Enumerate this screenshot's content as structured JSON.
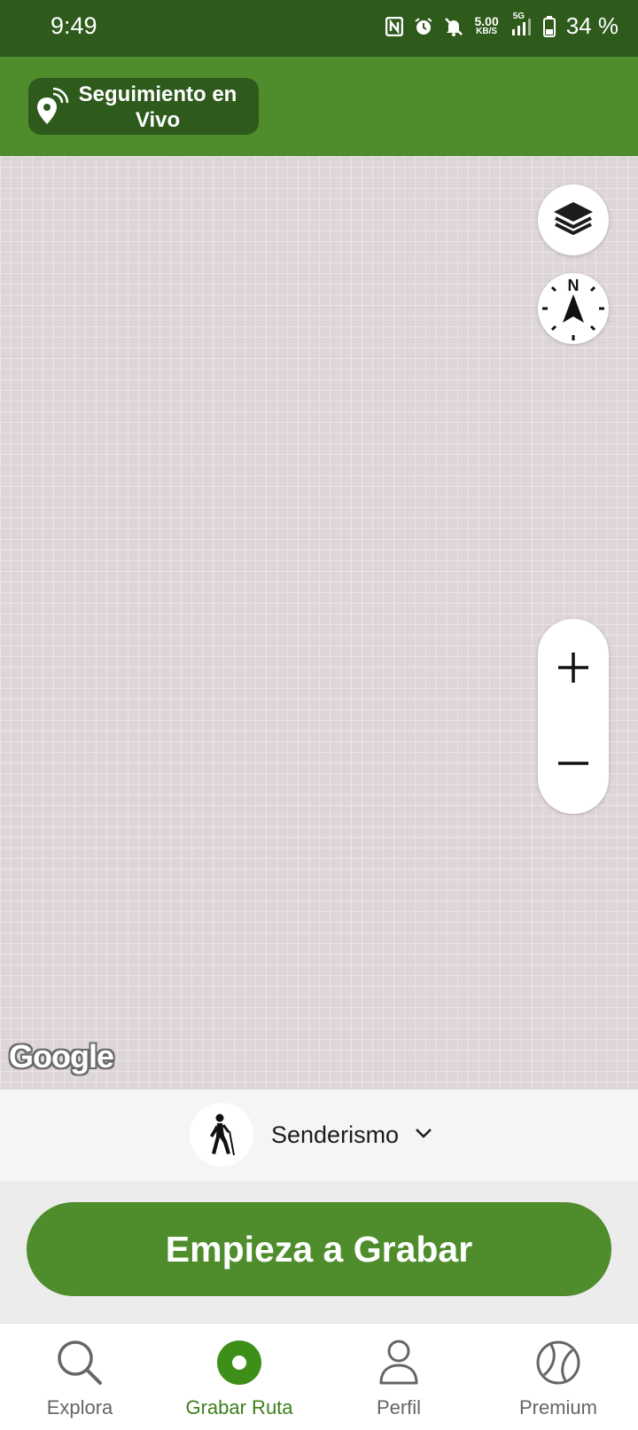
{
  "status_bar": {
    "time": "9:49",
    "net_speed_value": "5.00",
    "net_speed_unit": "KB/S",
    "network_type": "5G",
    "battery": "34 %",
    "icons": [
      "nfc-icon",
      "alarm-icon",
      "mute-icon",
      "signal-icon",
      "battery-icon"
    ]
  },
  "header": {
    "live_tracking_label": "Seguimiento en Vivo",
    "live_tracking_icon": "location-pin-broadcast-icon",
    "background_color": "#4f8c2c"
  },
  "map": {
    "layers_icon": "layers-icon",
    "compass_label": "N",
    "zoom_in_label": "+",
    "zoom_out_label": "−",
    "attribution": "Google"
  },
  "activity": {
    "label": "Senderismo",
    "icon": "hiking-icon"
  },
  "record_button": {
    "label": "Empieza a Grabar"
  },
  "bottom_nav": {
    "items": [
      {
        "label": "Explora",
        "icon": "search-icon",
        "active": false
      },
      {
        "label": "Grabar Ruta",
        "icon": "record-icon",
        "active": true
      },
      {
        "label": "Perfil",
        "icon": "user-icon",
        "active": false
      },
      {
        "label": "Premium",
        "icon": "premium-ball-icon",
        "active": false
      }
    ],
    "active_color": "#3e7f1e"
  }
}
